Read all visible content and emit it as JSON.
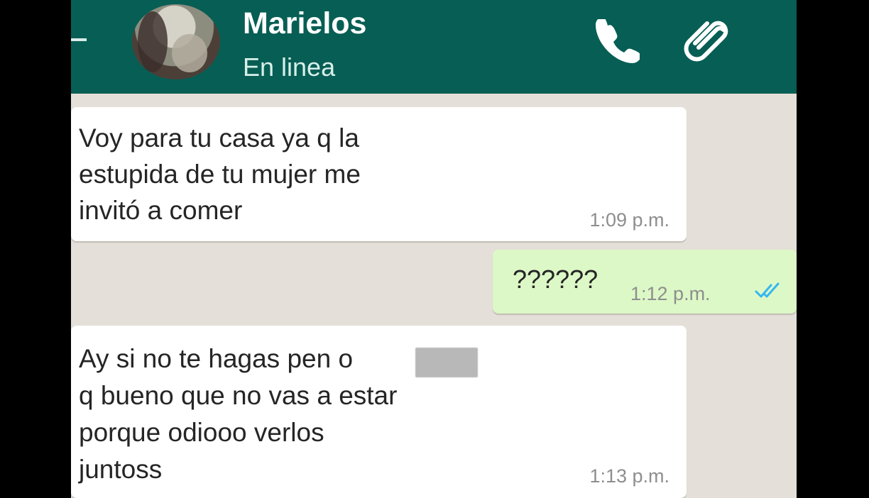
{
  "header": {
    "contact_name": "Marielos",
    "status": "En linea",
    "back_icon": "back-arrow-icon",
    "call_icon": "phone-icon",
    "attach_icon": "paperclip-icon"
  },
  "messages": [
    {
      "direction": "incoming",
      "text": "Voy para tu casa ya q la\nestupida de tu mujer me\ninvitó a comer",
      "time": "1:09 p.m."
    },
    {
      "direction": "outgoing",
      "text": "??????",
      "time": "1:12 p.m.",
      "status_icon": "double-check-icon",
      "status_color": "#34b7f1"
    },
    {
      "direction": "incoming",
      "text": "Ay si no te hagas pen      o\nq bueno que no vas a estar\nporque odiooo verlos\njuntoss",
      "time": "1:13 p.m."
    }
  ],
  "colors": {
    "header_background": "#075e54",
    "chat_background": "#e4dfd8",
    "incoming_bubble": "#ffffff",
    "outgoing_bubble": "#dcf8c6"
  }
}
